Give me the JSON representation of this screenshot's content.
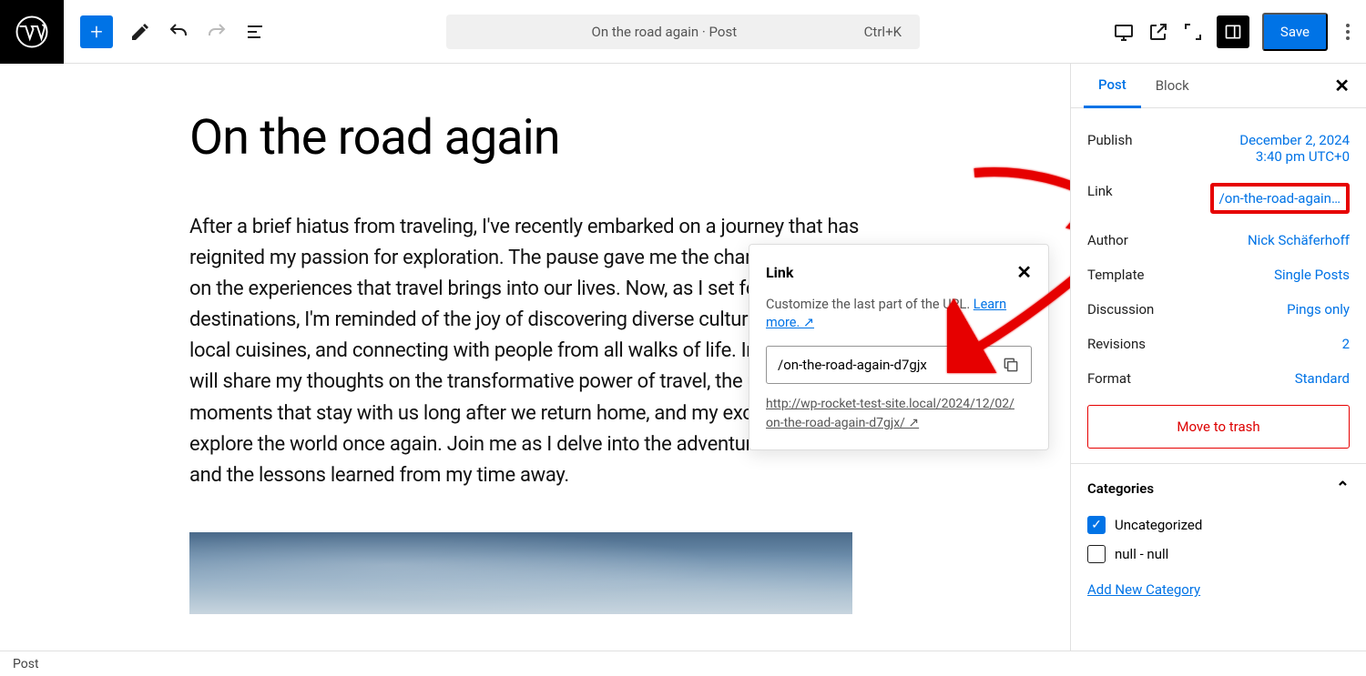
{
  "topbar": {
    "doc_title": "On the road again · Post",
    "shortcut": "Ctrl+K",
    "save": "Save"
  },
  "post": {
    "title": "On the road again",
    "body": "After a brief hiatus from traveling, I've recently embarked on a journey that has reignited my passion for exploration. The pause gave me the chance to reflect on the experiences that travel brings into our lives. Now, as I set foot in new destinations, I'm reminded of the joy of discovering diverse cultures, savoring local cuisines, and connecting with people from all walks of life. In this post, I will share my thoughts on the transformative power of travel, the unique moments that stay with us long after we return home, and my excitement to explore the world once again. Join me as I delve into the adventures that await and the lessons learned from my time away."
  },
  "link_popover": {
    "title": "Link",
    "desc_prefix": "Customize the last part of the URL. ",
    "learn_more": "Learn more. ↗",
    "slug": "/on-the-road-again-d7gjx",
    "full_url_line1": "http://wp-rocket-test-site.local/2024/12/02/",
    "full_url_line2": "on-the-road-again-d7gjx/ ↗"
  },
  "sidebar": {
    "tabs": {
      "post": "Post",
      "block": "Block"
    },
    "publish": {
      "label": "Publish",
      "date": "December 2, 2024",
      "time": "3:40 pm UTC+0"
    },
    "link": {
      "label": "Link",
      "value": "/on-the-road-again…"
    },
    "author": {
      "label": "Author",
      "value": "Nick Schäferhoff"
    },
    "template": {
      "label": "Template",
      "value": "Single Posts"
    },
    "discussion": {
      "label": "Discussion",
      "value": "Pings only"
    },
    "revisions": {
      "label": "Revisions",
      "value": "2"
    },
    "format": {
      "label": "Format",
      "value": "Standard"
    },
    "trash": "Move to trash",
    "categories": {
      "heading": "Categories",
      "items": [
        {
          "label": "Uncategorized",
          "checked": true
        },
        {
          "label": "null - null",
          "checked": false
        }
      ],
      "add": "Add New Category"
    }
  },
  "footer": {
    "breadcrumb": "Post"
  }
}
